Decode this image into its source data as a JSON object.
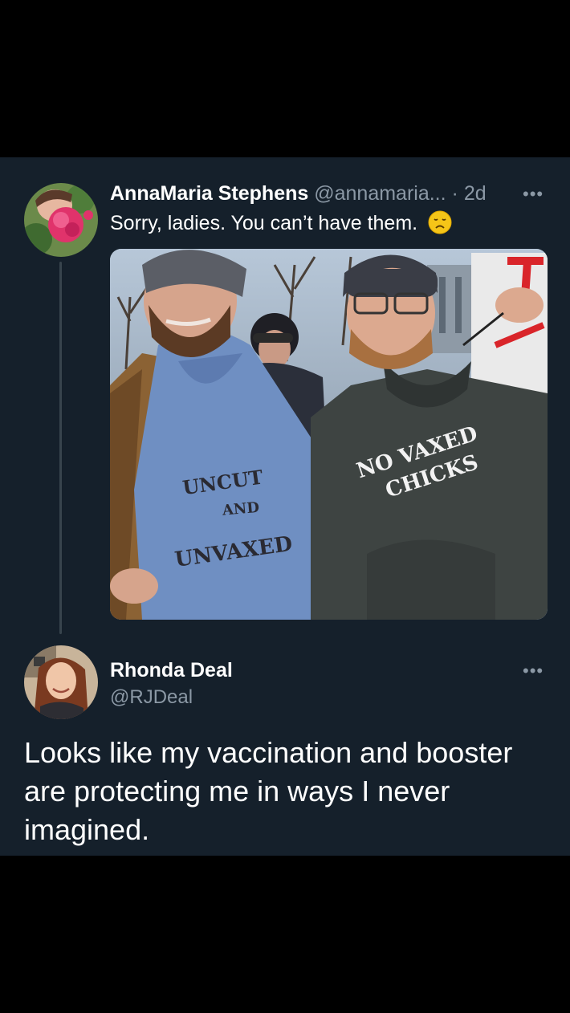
{
  "tweet": {
    "author_name": "AnnaMaria Stephens",
    "author_handle": "@annamaria...",
    "separator": "·",
    "time": "2d",
    "more": "•••",
    "text": "Sorry, ladies. You can’t have them.",
    "emoji": "disappointed-face-icon",
    "image": {
      "shirt_left": [
        "UNCUT",
        "AND",
        "UNVAXED"
      ],
      "shirt_right": [
        "NO VAXED",
        "CHICKS"
      ]
    }
  },
  "reply": {
    "author_name": "Rhonda Deal",
    "author_handle": "@RJDeal",
    "more": "•••",
    "text_lines": [
      "Looks like my vaccination and booster",
      "are protecting me in ways I never",
      "imagined."
    ]
  },
  "colors": {
    "background": "#15202b",
    "outer": "#000000",
    "secondary_text": "#8b98a5",
    "thread_line": "#38444d"
  }
}
